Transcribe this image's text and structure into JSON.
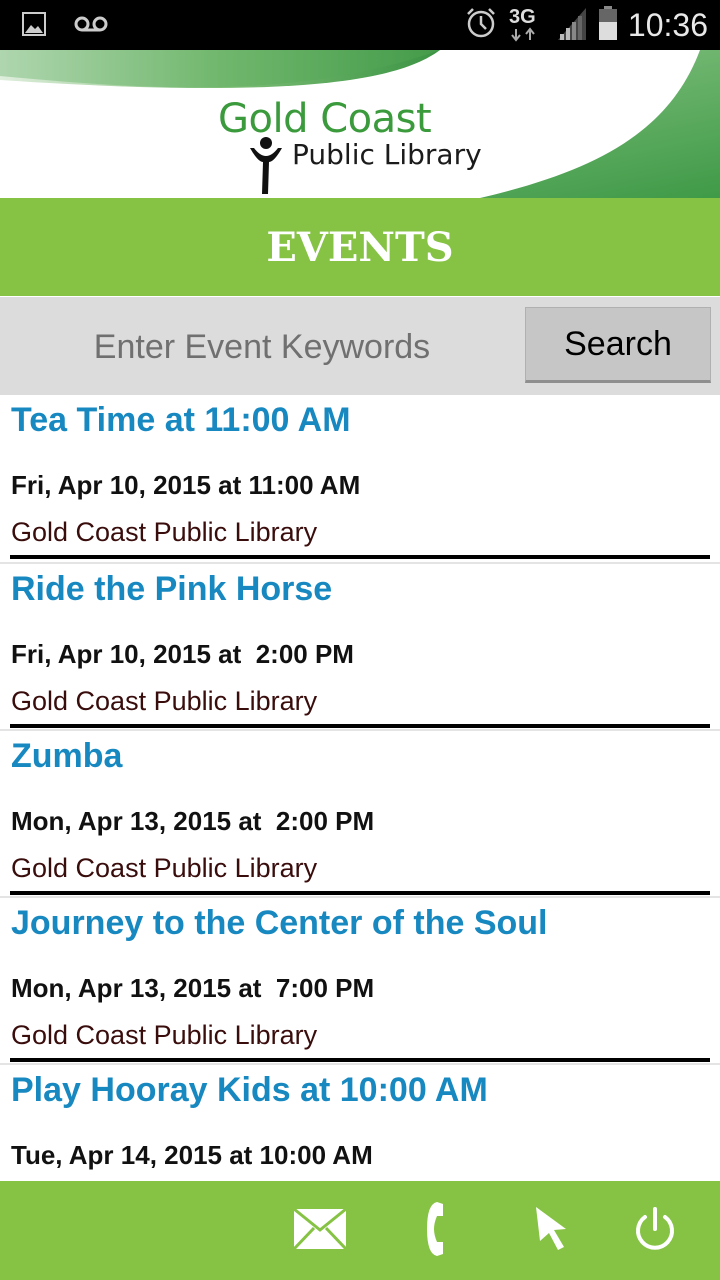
{
  "status_bar": {
    "time": "10:36",
    "network": "3G",
    "left_icons": [
      "image-icon",
      "voicemail-icon"
    ],
    "right_icons": [
      "alarm-icon",
      "3g-icon",
      "signal-icon",
      "battery-icon"
    ]
  },
  "header": {
    "logo_line1": "Gold Coast",
    "logo_line2": "Public Library",
    "page_title": "EVENTS"
  },
  "search": {
    "placeholder": "Enter Event Keywords",
    "value": "",
    "button_label": "Search"
  },
  "events": [
    {
      "title": "Tea Time at 11:00 AM",
      "date": "Fri, Apr 10, 2015 at 11:00 AM",
      "location": "Gold Coast Public Library"
    },
    {
      "title": "Ride the Pink Horse",
      "date": "Fri, Apr 10, 2015 at  2:00 PM",
      "location": "Gold Coast Public Library"
    },
    {
      "title": "Zumba",
      "date": "Mon, Apr 13, 2015 at  2:00 PM",
      "location": "Gold Coast Public Library"
    },
    {
      "title": "Journey to the Center of the Soul",
      "date": "Mon, Apr 13, 2015 at  7:00 PM",
      "location": "Gold Coast Public Library"
    },
    {
      "title": "Play Hooray Kids at 10:00 AM",
      "date": "Tue, Apr 14, 2015 at 10:00 AM",
      "location": ""
    }
  ],
  "footer": {
    "buttons": [
      "email-icon",
      "phone-icon",
      "cursor-icon",
      "power-icon"
    ]
  },
  "colors": {
    "brand_green": "#86c344",
    "logo_green": "#3a9a3c",
    "title_blue": "#1788c0",
    "location_brown": "#3a0d0d"
  }
}
